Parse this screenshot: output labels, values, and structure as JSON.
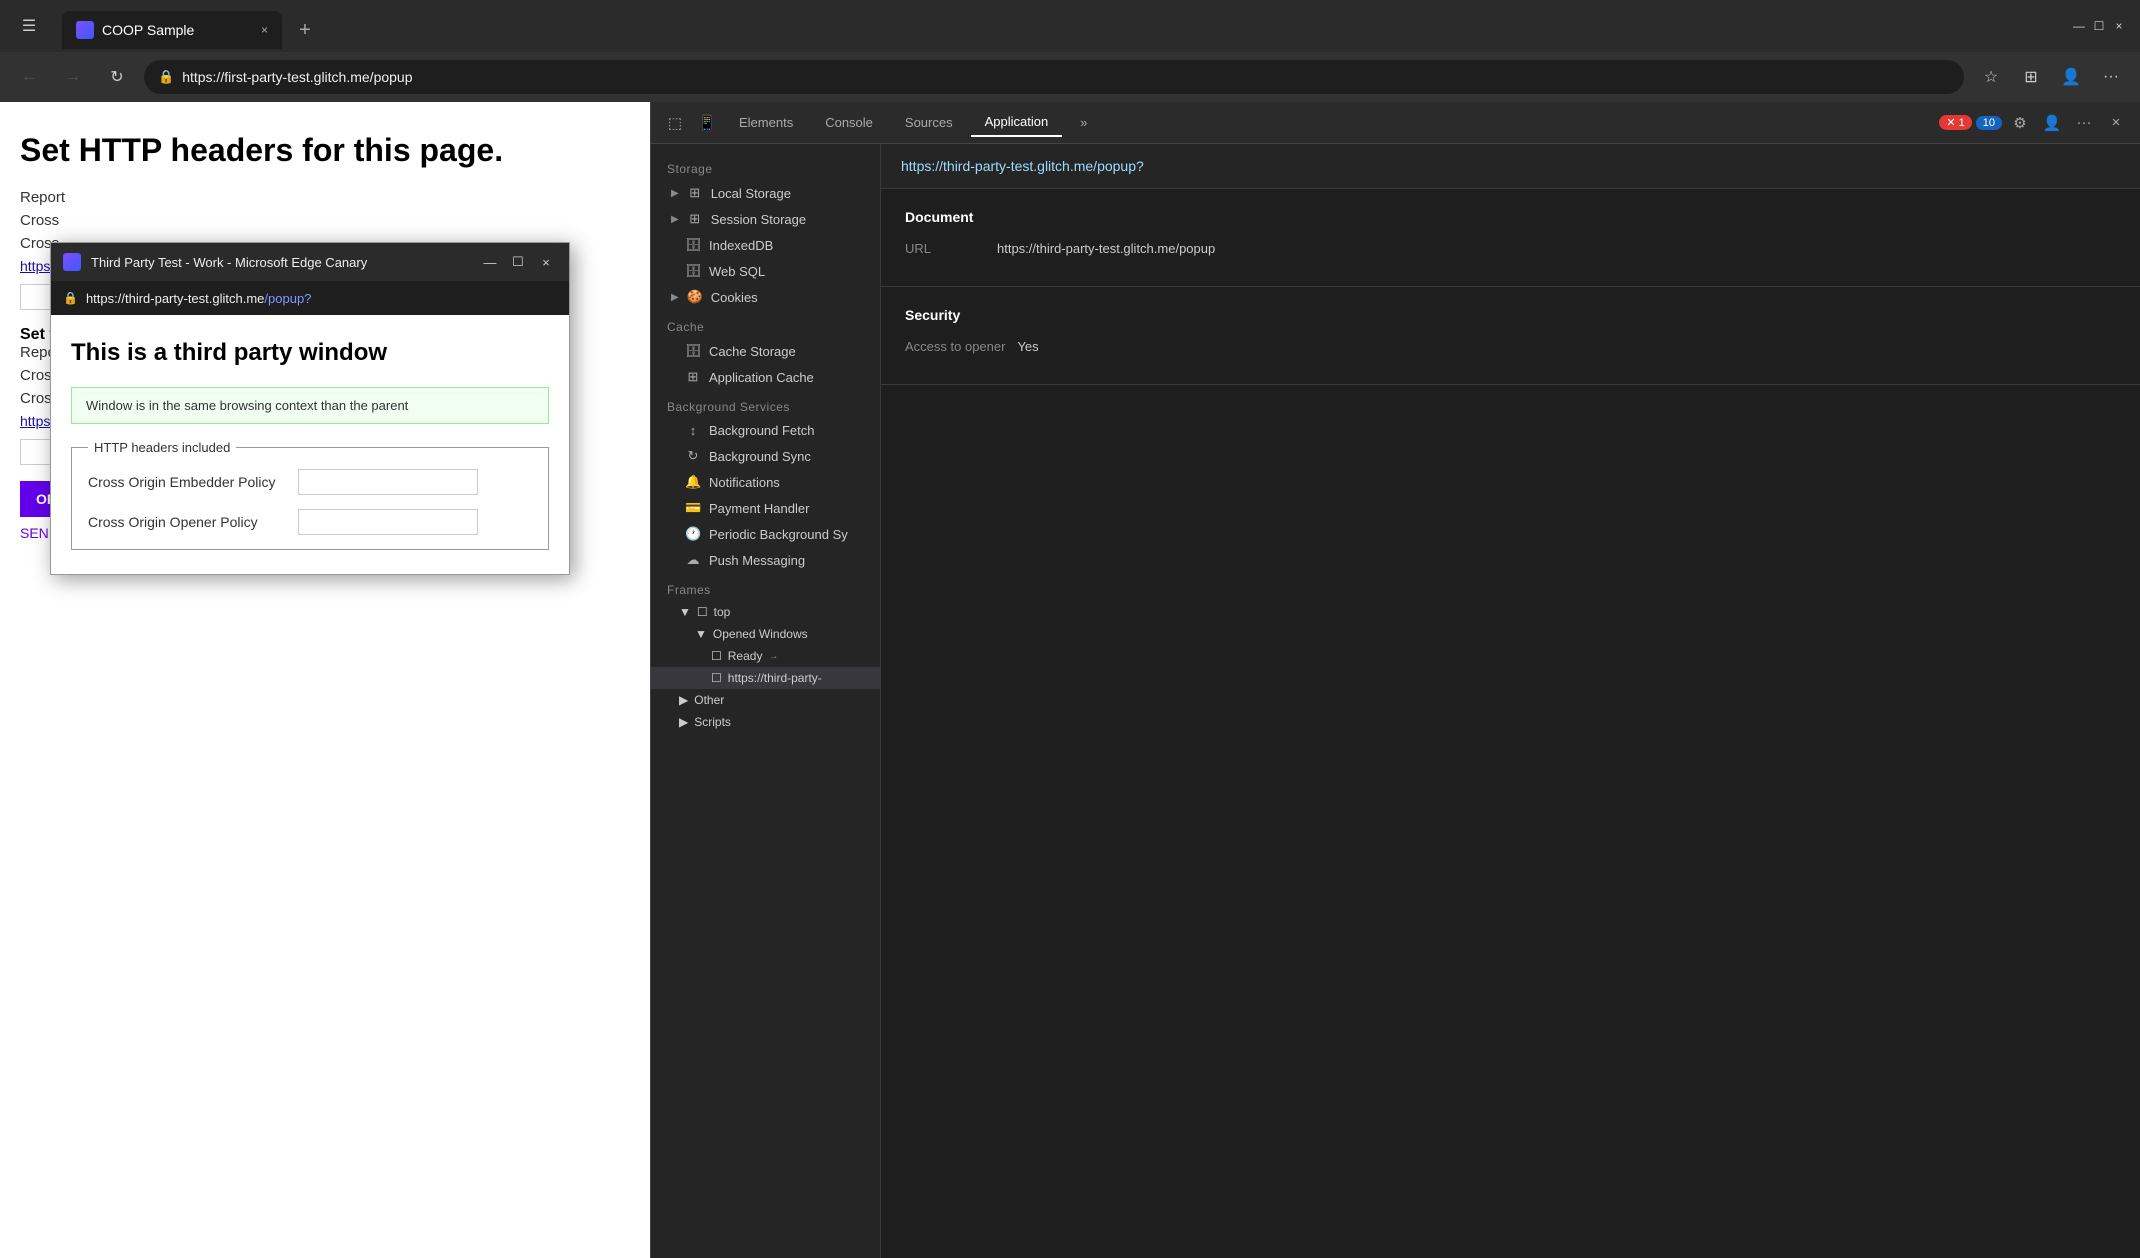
{
  "browser": {
    "tab_title": "COOP Sample",
    "tab_close": "×",
    "tab_new": "+",
    "address_url": "https://first-party-test.glitch.me/popup",
    "nav": {
      "back": "←",
      "forward": "→",
      "reload": "↻",
      "star": "☆",
      "collections": "⊞",
      "profile": "👤",
      "more": "···"
    },
    "title_bar_min": "—",
    "title_bar_max": "☐",
    "title_bar_close": "×"
  },
  "webpage": {
    "heading": "Set HTTP headers for this page.",
    "lines": [
      "Report",
      "Cross",
      "Cross"
    ],
    "link": "https://"
  },
  "popup": {
    "titlebar_title": "Third Party Test - Work - Microsoft Edge Canary",
    "ctrl_min": "—",
    "ctrl_max": "☐",
    "ctrl_close": "×",
    "address_lock": "🔒",
    "url_base": "https://third-party-test.glitch.me",
    "url_path": "/popup?",
    "heading": "This is a third party window",
    "info_text": "Window is in the same browsing context than the parent",
    "fieldset_legend": "HTTP headers included",
    "field1_label": "Cross Origin Embedder Policy",
    "field2_label": "Cross Origin Opener Policy"
  },
  "devtools": {
    "tabs": {
      "cursor_icon": "⬚",
      "device_icon": "📱",
      "elements": "Elements",
      "console": "Console",
      "sources": "Sources",
      "application": "Application",
      "more": "»",
      "errors_count": "1",
      "warnings_count": "10",
      "gear": "⚙",
      "profile": "👤",
      "more_actions": "···",
      "close": "×"
    },
    "main_url": "https://third-party-test.glitch.me/popup?",
    "document_section": {
      "title": "Document",
      "url_label": "URL",
      "url_value": "https://third-party-test.glitch.me/popup"
    },
    "security_section": {
      "title": "Security",
      "access_label": "Access to opener",
      "access_value": "Yes"
    },
    "sidebar": {
      "storage_label": "Storage",
      "local_storage": "Local Storage",
      "session_storage": "Session Storage",
      "indexeddb": "IndexedDB",
      "web_sql": "Web SQL",
      "cookies": "Cookies",
      "cache_label": "Cache",
      "cache_storage": "Cache Storage",
      "application_cache": "Application Cache",
      "bg_services_label": "Background Services",
      "background_fetch": "Background Fetch",
      "background_sync": "Background Sync",
      "notifications": "Notifications",
      "payment_handler": "Payment Handler",
      "periodic_bg_sync": "Periodic Background Sy",
      "push_messaging": "Push Messaging",
      "frames_label": "Frames",
      "frames_top": "top",
      "opened_windows": "Opened Windows",
      "ready": "Ready",
      "third_party_url": "https://third-party-",
      "other": "Other",
      "scripts": "Scripts"
    }
  }
}
